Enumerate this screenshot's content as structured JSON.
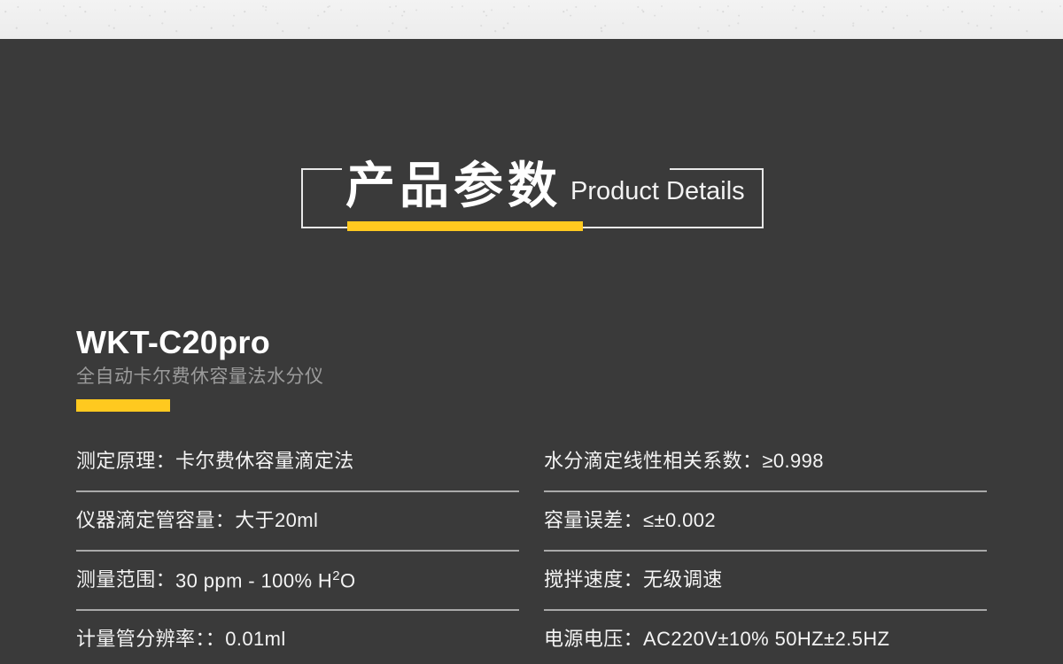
{
  "header": {
    "title_cn": "产品参数",
    "title_en": "Product Details",
    "accent_color": "#ffc91f",
    "frame_color": "#e8e8e8"
  },
  "product": {
    "name": "WKT-C20pro",
    "subtitle": "全自动卡尔费休容量法水分仪",
    "accent_color": "#ffc91f"
  },
  "theme": {
    "background": "#3a3a3a",
    "top_strip": "#f0f0f0",
    "text_primary": "#f4f4f4",
    "text_secondary": "#9b9b9b",
    "divider": "#a9a9a9"
  },
  "specs": {
    "left_column": [
      {
        "label": "测定原理：",
        "value": "卡尔费休容量滴定法"
      },
      {
        "label": "仪器滴定管容量：",
        "value": "大于20ml"
      },
      {
        "label": "测量范围：",
        "value": "30 ppm - 100% H²O"
      },
      {
        "label": "计量管分辨率：：",
        "value": "0.01ml"
      }
    ],
    "right_column": [
      {
        "label": "水分滴定线性相关系数：",
        "value": "≥0.998"
      },
      {
        "label": "容量误差：",
        "value": "≤±0.002"
      },
      {
        "label": "搅拌速度：",
        "value": "无级调速"
      },
      {
        "label": "电源电压：",
        "value": "AC220V±10% 50HZ±2.5HZ"
      }
    ]
  }
}
